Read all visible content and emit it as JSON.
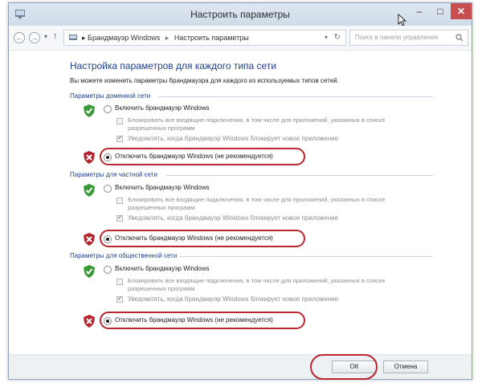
{
  "window": {
    "title": "Настроить параметры",
    "controls": {
      "minimize": "–",
      "maximize": "□",
      "close": "✕"
    }
  },
  "nav": {
    "back": "←",
    "forward": "→",
    "up": "↑",
    "breadcrumb": [
      "Брандмауэр Windows",
      "Настроить параметры"
    ],
    "search_placeholder": "Поиск в панели управления"
  },
  "main": {
    "heading": "Настройка параметров для каждого типа сети",
    "description": "Вы можете изменить параметры брандмауэра для каждого из используемых типов сетей."
  },
  "groups": [
    {
      "title": "Параметры доменной сети",
      "enable_label": "Включить брандмауэр Windows",
      "enable_selected": false,
      "block_label": "Блокировать все входящие подключения, в том числе для приложений, указанных в списке разрешенных программ",
      "block_checked": false,
      "notify_label": "Уведомлять, когда брандмауэр Windows блокирует новое приложение",
      "notify_checked": true,
      "disable_label": "Отключить брандмауэр Windows (не рекомендуется)",
      "disable_selected": true
    },
    {
      "title": "Параметры для частной сети",
      "enable_label": "Включить брандмауэр Windows",
      "enable_selected": false,
      "block_label": "Блокировать все входящие подключения, в том числе для приложений, указанных в списке разрешенных программ",
      "block_checked": false,
      "notify_label": "Уведомлять, когда брандмауэр Windows блокирует новое приложение",
      "notify_checked": true,
      "disable_label": "Отключить брандмауэр Windows (не рекомендуется)",
      "disable_selected": true
    },
    {
      "title": "Параметры для общественной сети",
      "enable_label": "Включить брандмауэр Windows",
      "enable_selected": false,
      "block_label": "Блокировать все входящие подключения, в том числе для приложений, указанных в списке разрешенных программ",
      "block_checked": false,
      "notify_label": "Уведомлять, когда брандмауэр Windows блокирует новое приложение",
      "notify_checked": true,
      "disable_label": "Отключить брандмауэр Windows (не рекомендуется)",
      "disable_selected": true
    }
  ],
  "buttons": {
    "ok": "ОК",
    "cancel": "Отмена"
  },
  "colors": {
    "heading": "#1e3f8a",
    "highlight_oval": "#b8262f",
    "shield_on": "#3a9a3a",
    "shield_off": "#b3262d"
  }
}
